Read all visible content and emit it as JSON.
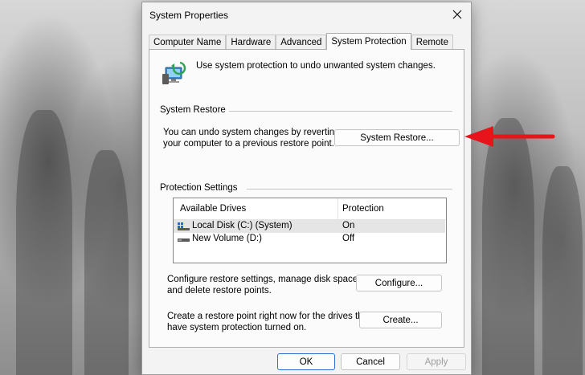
{
  "window": {
    "title": "System Properties"
  },
  "tabs": [
    {
      "label": "Computer Name",
      "active": false
    },
    {
      "label": "Hardware",
      "active": false
    },
    {
      "label": "Advanced",
      "active": false
    },
    {
      "label": "System Protection",
      "active": true
    },
    {
      "label": "Remote",
      "active": false
    }
  ],
  "intro": {
    "text": "Use system protection to undo unwanted system changes."
  },
  "system_restore": {
    "group_label": "System Restore",
    "description_line1": "You can undo system changes by reverting",
    "description_line2": "your computer to a previous restore point.",
    "button_label": "System Restore..."
  },
  "protection_settings": {
    "group_label": "Protection Settings",
    "columns": [
      "Available Drives",
      "Protection"
    ],
    "drives": [
      {
        "name": "Local Disk (C:) (System)",
        "protection": "On",
        "selected": true,
        "icon": "system-drive-icon"
      },
      {
        "name": "New Volume (D:)",
        "protection": "Off",
        "selected": false,
        "icon": "drive-icon"
      }
    ],
    "configure_text_line1": "Configure restore settings, manage disk space,",
    "configure_text_line2": "and delete restore points.",
    "configure_label": "Configure...",
    "create_text_line1": "Create a restore point right now for the drives that",
    "create_text_line2": "have system protection turned on.",
    "create_label": "Create..."
  },
  "footer": {
    "ok_label": "OK",
    "cancel_label": "Cancel",
    "apply_label": "Apply"
  },
  "annotation": {
    "arrow_color": "#e8141b"
  },
  "colors": {
    "primary_border": "#2b6fd1",
    "selected_row": "#e5e5e5"
  }
}
